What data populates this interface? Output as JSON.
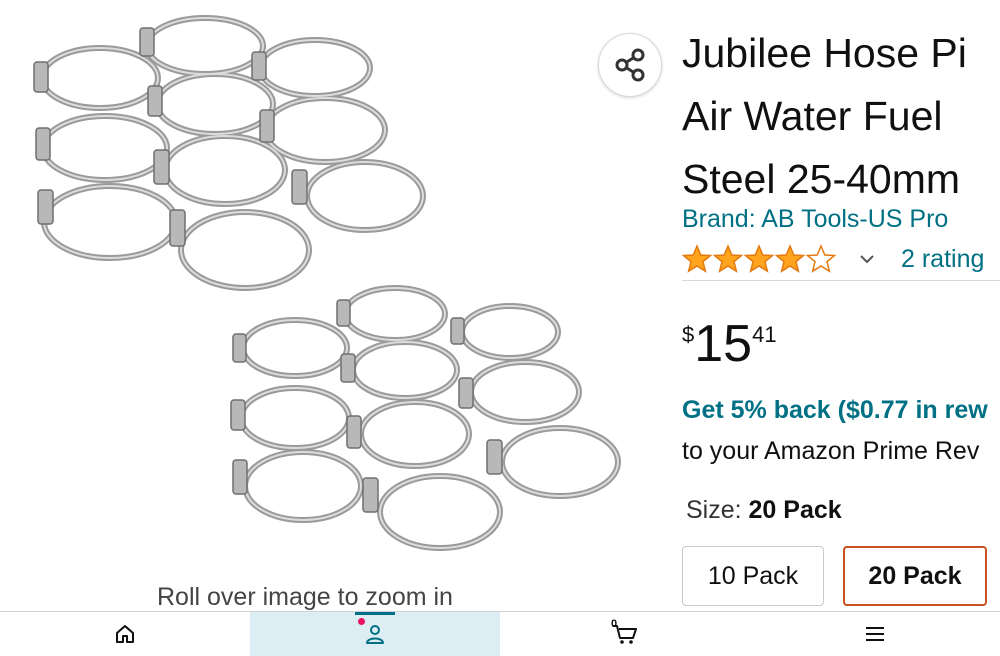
{
  "product": {
    "title_lines": [
      "Jubilee Hose Pi",
      "Air Water Fuel ",
      "Steel 25-40mm"
    ],
    "brand": "Brand: AB Tools-US Pro",
    "rating_stars": 4.0,
    "ratings_text": "2 rating",
    "price": {
      "currency": "$",
      "whole": "15",
      "fraction": "41"
    },
    "cashback": "Get 5% back ($0.77 in rew",
    "cashback_sub": "to your Amazon Prime Rev",
    "size_label": "Size: ",
    "size_value": "20 Pack",
    "size_options": [
      "10 Pack",
      "20 Pack"
    ],
    "selected_size": "20 Pack"
  },
  "gallery": {
    "zoom_hint": "Roll over image to zoom in"
  },
  "bottom_nav": {
    "items": [
      "home-icon",
      "account-icon",
      "cart-icon",
      "menu-icon"
    ],
    "active": "account-icon",
    "cart_count": "0"
  },
  "colors": {
    "link": "#007185",
    "star": "#ffa41c",
    "selected_border": "#c7511f",
    "nav_active_bg": "#dcedf3",
    "notification_dot": "#e8115e"
  }
}
